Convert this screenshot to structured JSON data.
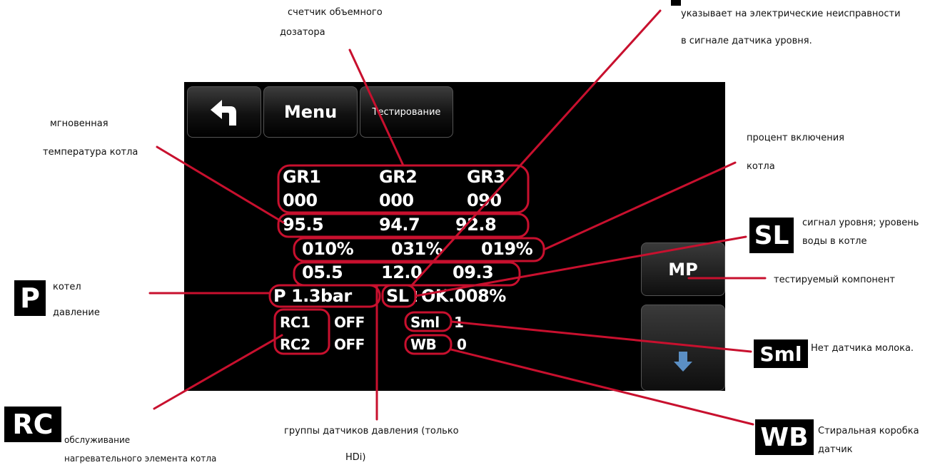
{
  "screen": {
    "buttons": {
      "menu": "Menu",
      "test": "Тестирование",
      "mp": "MP"
    },
    "groups": {
      "gr1": "GR1",
      "gr2": "GR2",
      "gr3": "GR3"
    },
    "counters": {
      "c1": "000",
      "c2": "000",
      "c3": "090"
    },
    "temperatures": {
      "t1": "95.5",
      "t2": "94.7",
      "t3": "92.8"
    },
    "percents": {
      "p1": "010%",
      "p2": "031%",
      "p3": "019%"
    },
    "pressure_groups": {
      "v1": "05.5",
      "v2": "12.0",
      "v3": "09.3"
    },
    "boiler": {
      "pressure": "P 1.3bar",
      "sl": "SL",
      "bang": "!",
      "status": "OK.008%"
    },
    "rc1": {
      "label": "RC1",
      "value": "OFF"
    },
    "rc2": {
      "label": "RC2",
      "value": "OFF"
    },
    "sml": {
      "label": "Sml",
      "value": "1"
    },
    "wb": {
      "label": "WB",
      "value": "0"
    }
  },
  "annotations": {
    "counter_1": "счетчик объемного",
    "counter_2": "дозатора",
    "fault_1": "указывает на электрические неисправности",
    "fault_2": "в сигнале датчика уровня.",
    "temp_1": "мгновенная",
    "temp_2": "температура котла",
    "percent_1": "процент включения",
    "percent_2": "котла",
    "sl_1": "сигнал уровня; уровень",
    "sl_2": "воды в котле",
    "tested": "тестируемый компонент",
    "p_1": "котел",
    "p_2": "давление",
    "sml": "Нет датчика молока.",
    "rc_1": "обслуживание",
    "rc_2": "нагревательного элемента котла",
    "groups_1": "группы датчиков давления (только",
    "groups_2": "HDi)",
    "wb_1": "Стиральная коробка",
    "wb_2": "датчик"
  },
  "icons": {
    "p": "P",
    "sl": "SL",
    "sml": "Sml",
    "rc": "RC",
    "wb": "WB"
  },
  "colors": {
    "callout": "#c8102e",
    "screen": "#000000",
    "text": "#ffffff"
  }
}
